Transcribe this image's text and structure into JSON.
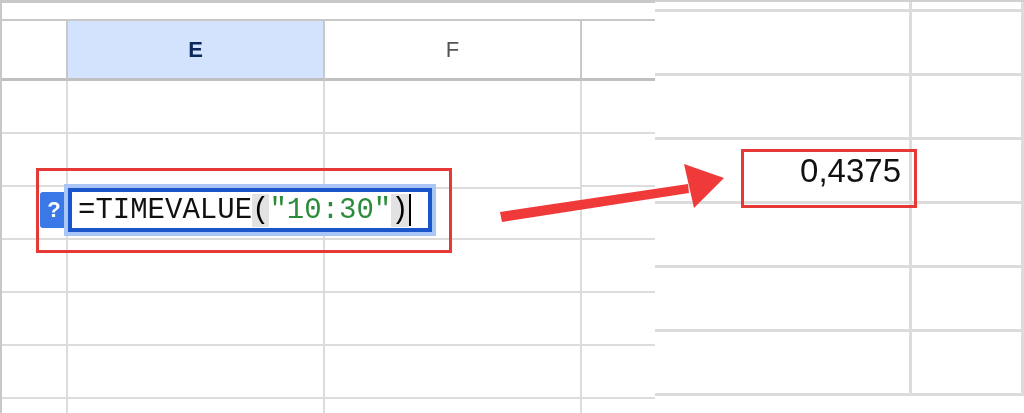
{
  "left_sheet": {
    "columns": [
      {
        "label": "E",
        "selected": true
      },
      {
        "label": "F",
        "selected": false
      }
    ],
    "formula_editor": {
      "help_label": "?",
      "parts": [
        {
          "kind": "function",
          "text": "=TIMEVALUE"
        },
        {
          "kind": "paren",
          "text": "("
        },
        {
          "kind": "string",
          "text": "\"10:30\""
        },
        {
          "kind": "paren",
          "text": ")"
        }
      ]
    }
  },
  "right_sheet": {
    "result_cell": "0,4375"
  }
}
